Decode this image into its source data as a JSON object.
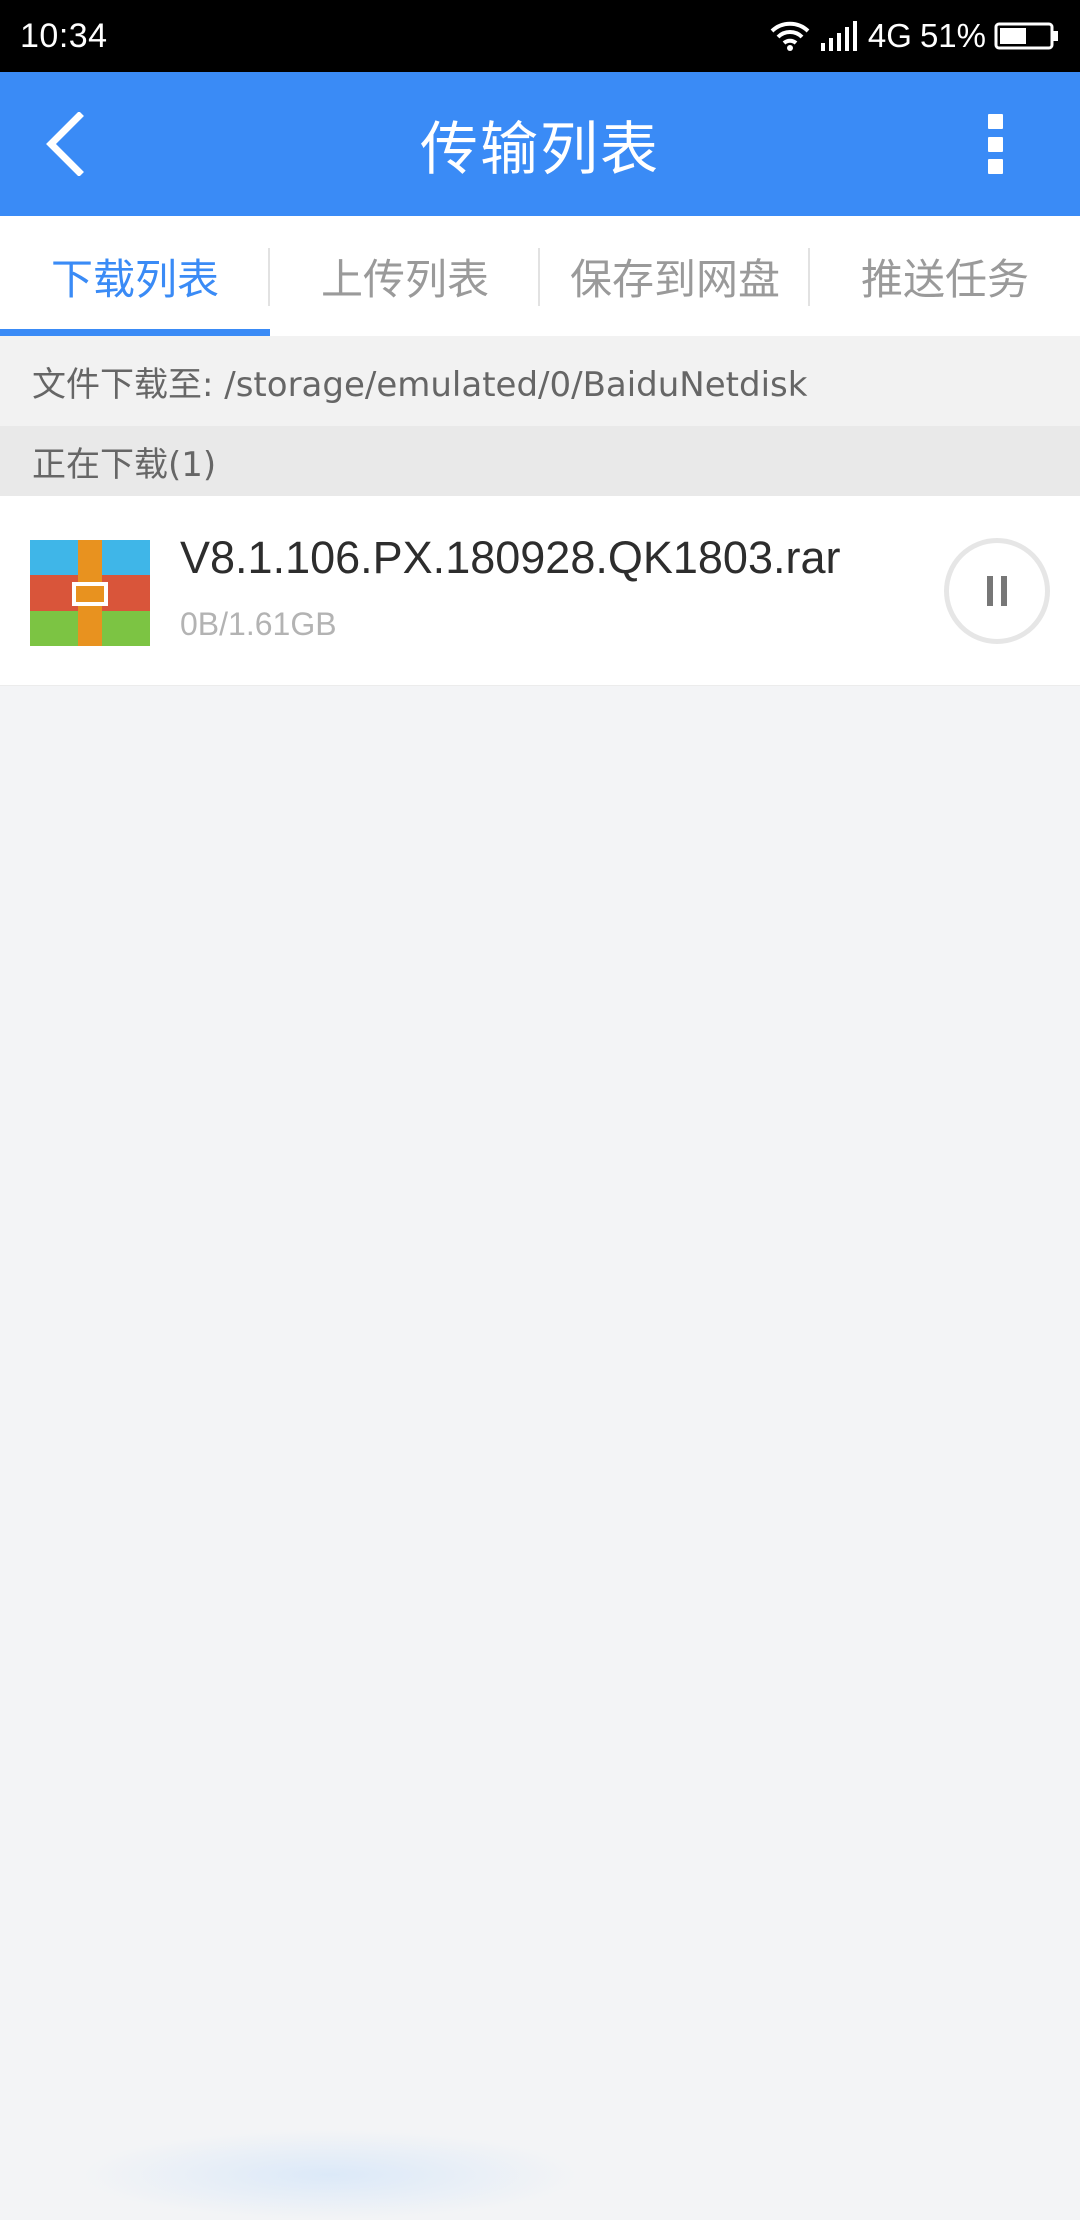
{
  "status_bar": {
    "time": "10:34",
    "network": "4G",
    "battery": "51%",
    "icons": [
      "wifi-icon",
      "signal-icon",
      "battery-icon"
    ]
  },
  "app_bar": {
    "title": "传输列表",
    "back_icon": "chevron-left-icon",
    "more_icon": "more-vertical-icon"
  },
  "tabs": [
    {
      "label": "下载列表",
      "active": true
    },
    {
      "label": "上传列表",
      "active": false
    },
    {
      "label": "保存到网盘",
      "active": false
    },
    {
      "label": "推送任务",
      "active": false
    }
  ],
  "download_path": "文件下载至: /storage/emulated/0/BaiduNetdisk",
  "section_header": "正在下载(1)",
  "downloads": [
    {
      "file_name": "V8.1.106.PX.180928.QK1803.rar",
      "progress": "0B/1.61GB",
      "icon": "archive-file-icon",
      "action_icon": "pause-icon"
    }
  ],
  "colors": {
    "primary": "#3a8bf6",
    "status_bar": "#000000",
    "background": "#f3f4f6"
  }
}
